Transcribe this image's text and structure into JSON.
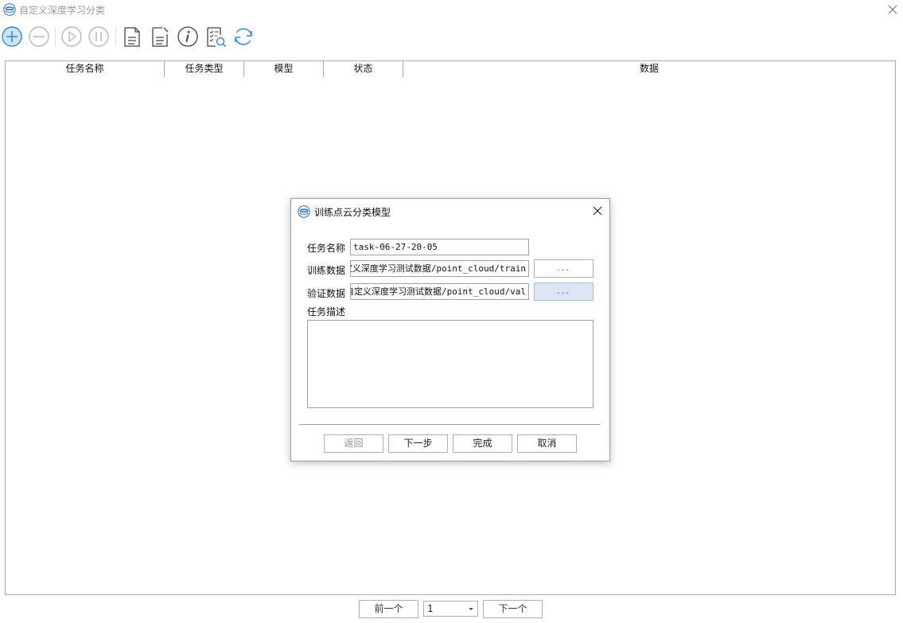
{
  "window": {
    "title": "自定义深度学习分类"
  },
  "toolbar": {
    "buttons": [
      "add-icon",
      "remove-icon",
      "play-icon",
      "pause-icon",
      "report-icon",
      "edit-document-icon",
      "info-icon",
      "inspect-list-icon",
      "refresh-icon"
    ],
    "accent": "#2f8ae0",
    "disabled_color": "#b8b8b8"
  },
  "table": {
    "columns": [
      "任务名称",
      "任务类型",
      "模型",
      "状态",
      "数据"
    ],
    "rows": []
  },
  "pager": {
    "prev_label": "前一个",
    "page_value": "1",
    "next_label": "下一个"
  },
  "dialog": {
    "title": "训练点云分类模型",
    "task_name_label": "任务名称",
    "task_name_value": "task-06-27-20-05",
    "train_data_label": "训练数据",
    "train_data_value": "自定义深度学习测试数据/point_cloud/train",
    "val_data_label": "验证数据",
    "val_data_value": "自定义深度学习测试数据/point_cloud/val",
    "browse_label": "...",
    "desc_label": "任务描述",
    "desc_value": "",
    "back_label": "返回",
    "next_label": "下一步",
    "finish_label": "完成",
    "cancel_label": "取消"
  }
}
